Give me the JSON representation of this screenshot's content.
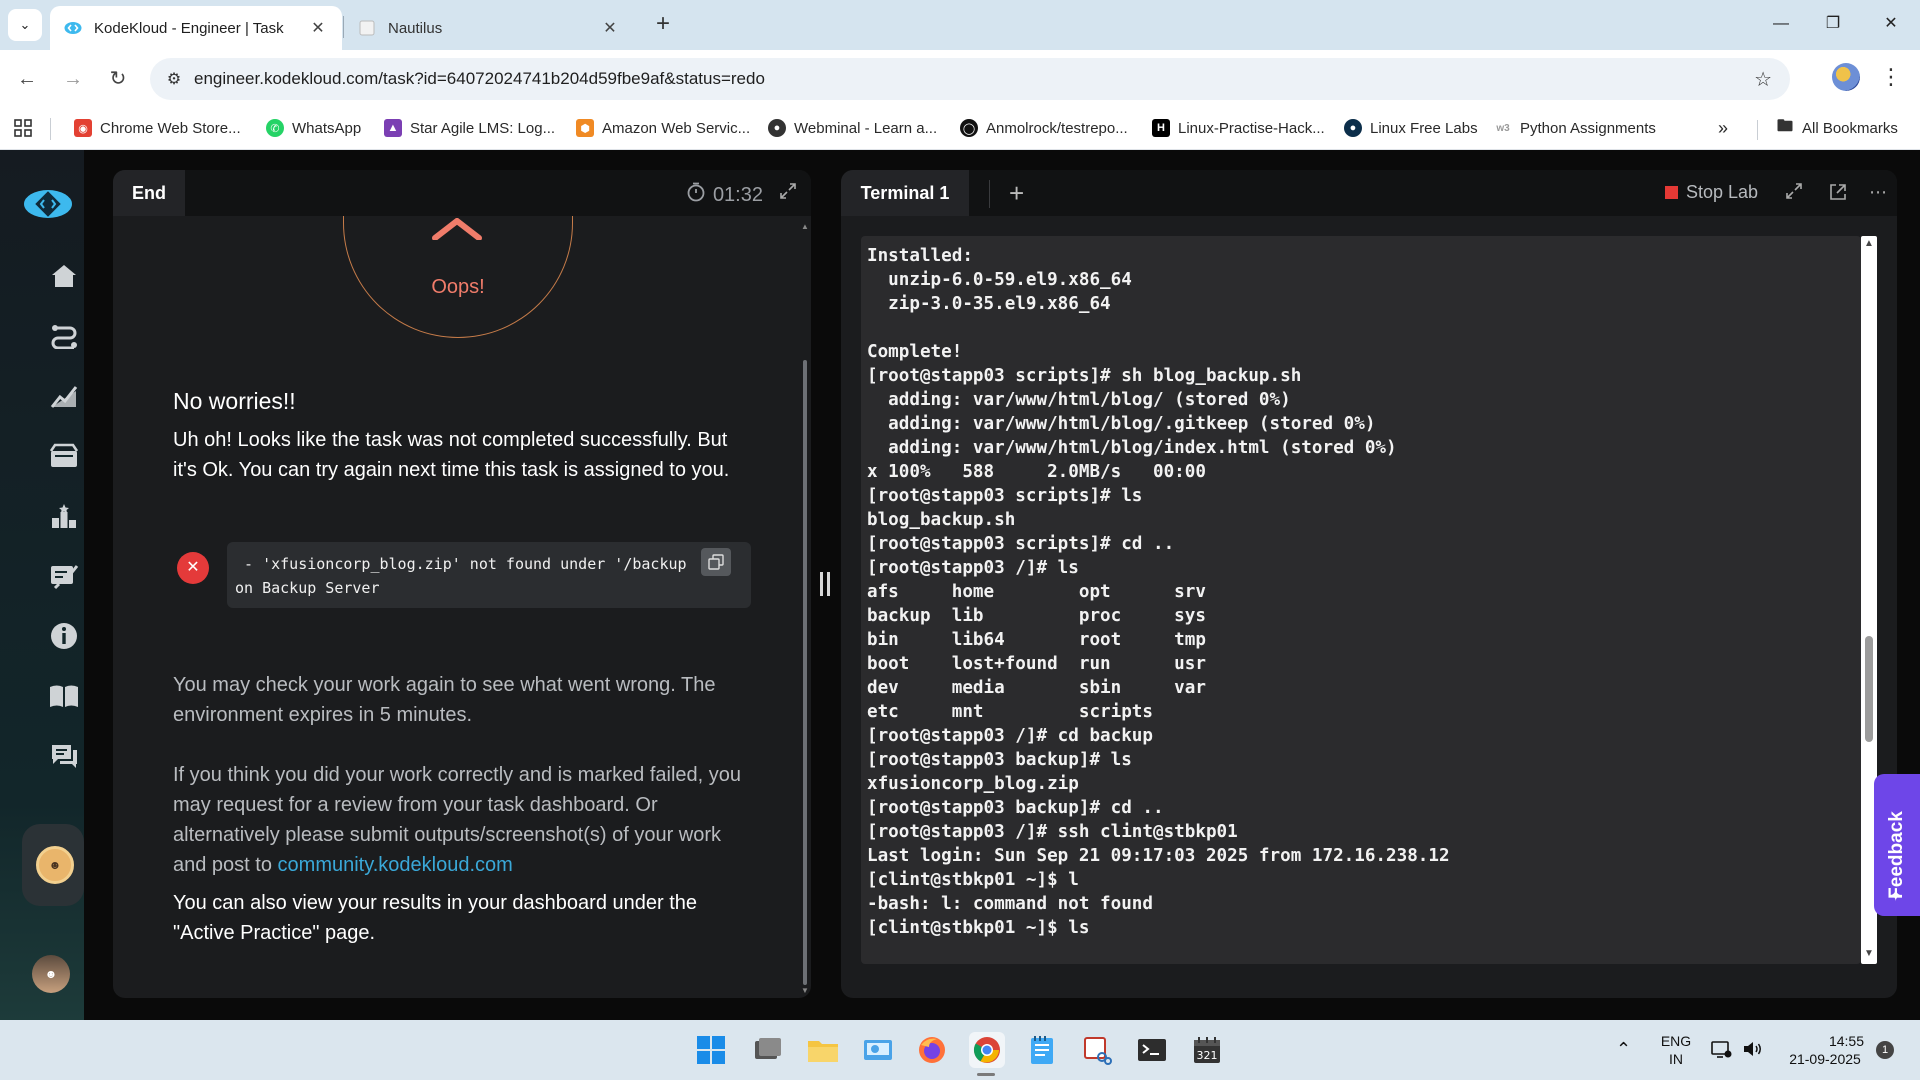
{
  "browser": {
    "tabs": [
      {
        "title": "KodeKloud - Engineer | Task",
        "active": true
      },
      {
        "title": "Nautilus",
        "active": false
      }
    ],
    "url": "engineer.kodekloud.com/task?id=64072024741b204d59fbe9af&status=redo",
    "bookmarks": [
      {
        "label": "Chrome Web Store...",
        "color": "#e34133"
      },
      {
        "label": "WhatsApp",
        "color": "#25d366"
      },
      {
        "label": "Star Agile LMS: Log...",
        "color": "#7b3fb3"
      },
      {
        "label": "Amazon Web Servic...",
        "color": "#f08a24"
      },
      {
        "label": "Webminal - Learn a...",
        "color": "#333333"
      },
      {
        "label": "Anmolrock/testrepo...",
        "color": "#111111"
      },
      {
        "label": "Linux-Practise-Hack...",
        "color": "#000000"
      },
      {
        "label": "Linux Free Labs",
        "color": "#0c2e4a"
      },
      {
        "label": "Python Assignments",
        "color": "#cfcfcf"
      }
    ],
    "all_bookmarks": "All Bookmarks"
  },
  "left_panel": {
    "tab": "End",
    "timer": "01:32",
    "oops": "Oops!",
    "heading": "No worries!!",
    "message": "Uh oh! Looks like the task was not completed successfully. But it's Ok. You can try again next time this task is assigned to you.",
    "error_text": " - 'xfusioncorp_blog.zip' not found under '/backup\non Backup Server",
    "check_text": "You may check your work again to see what went wrong. The environment expires in 5 minutes.",
    "review_text": "If you think you did your work correctly and is marked failed, you may request for a review from your task dashboard. Or alternatively please submit outputs/screenshot(s) of your work and post to",
    "review_link": "community.kodekloud.com",
    "dashboard_text": "You can also view your results in your dashboard under the \"Active Practice\" page."
  },
  "right_panel": {
    "tab": "Terminal 1",
    "stop_lab": "Stop Lab",
    "lines": [
      "Installed:",
      "  unzip-6.0-59.el9.x86_64",
      "  zip-3.0-35.el9.x86_64",
      "",
      "Complete!",
      "[root@stapp03 scripts]# sh blog_backup.sh",
      "  adding: var/www/html/blog/ (stored 0%)",
      "  adding: var/www/html/blog/.gitkeep (stored 0%)",
      "  adding: var/www/html/blog/index.html (stored 0%)",
      "x 100%   588     2.0MB/s   00:00",
      "[root@stapp03 scripts]# ls",
      "blog_backup.sh",
      "[root@stapp03 scripts]# cd ..",
      "[root@stapp03 /]# ls",
      "afs     home        opt      srv",
      "backup  lib         proc     sys",
      "bin     lib64       root     tmp",
      "boot    lost+found  run      usr",
      "dev     media       sbin     var",
      "etc     mnt         scripts",
      "[root@stapp03 /]# cd backup",
      "[root@stapp03 backup]# ls",
      "xfusioncorp_blog.zip",
      "[root@stapp03 backup]# cd ..",
      "[root@stapp03 /]# ssh clint@stbkp01",
      "Last login: Sun Sep 21 09:17:03 2025 from 172.16.238.12",
      "[clint@stbkp01 ~]$ l",
      "-bash: l: command not found",
      "[clint@stbkp01 ~]$ ls"
    ]
  },
  "feedback": "Feedback",
  "taskbar": {
    "lang_top": "ENG",
    "lang_bottom": "IN",
    "time": "14:55",
    "date": "21-09-2025",
    "notif_count": "1"
  }
}
